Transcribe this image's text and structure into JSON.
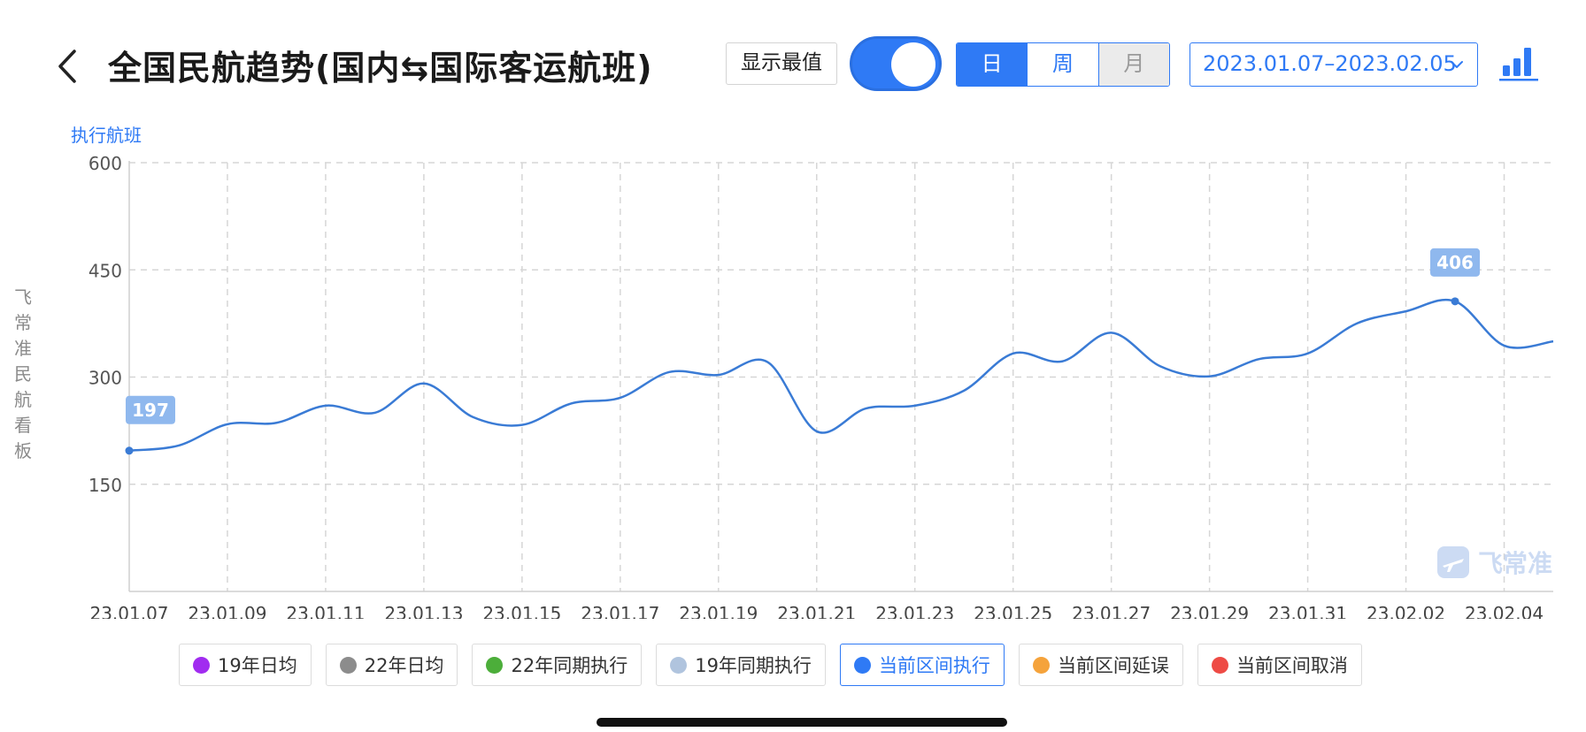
{
  "header": {
    "title": "全国民航趋势(国内⇆国际客运航班)",
    "show_max_label": "显示最值",
    "toggle_on": true,
    "periods": [
      "日",
      "周",
      "月"
    ],
    "selected_period": "日",
    "date_range": "2023.01.07–2023.02.05"
  },
  "vertical_label": "飞常准民航看板",
  "watermark": "飞常准",
  "colors": {
    "accent": "#2f7af5",
    "line": "#3a7bd5",
    "badge": "#8fb8ee"
  },
  "chart_data": {
    "type": "line",
    "ylabel": "执行航班",
    "ylim": [
      0,
      600
    ],
    "yticks": [
      150,
      300,
      450,
      600
    ],
    "x": [
      "23.01.07",
      "23.01.08",
      "23.01.09",
      "23.01.10",
      "23.01.11",
      "23.01.12",
      "23.01.13",
      "23.01.14",
      "23.01.15",
      "23.01.16",
      "23.01.17",
      "23.01.18",
      "23.01.19",
      "23.01.20",
      "23.01.21",
      "23.01.22",
      "23.01.23",
      "23.01.24",
      "23.01.25",
      "23.01.26",
      "23.01.27",
      "23.01.28",
      "23.01.29",
      "23.01.30",
      "23.01.31",
      "23.02.01",
      "23.02.02",
      "23.02.03",
      "23.02.04",
      "23.02.05"
    ],
    "xtick_labels": [
      "23.01.07",
      "23.01.09",
      "23.01.11",
      "23.01.13",
      "23.01.15",
      "23.01.17",
      "23.01.19",
      "23.01.21",
      "23.01.23",
      "23.01.25",
      "23.01.27",
      "23.01.29",
      "23.01.31",
      "23.02.02",
      "23.02.04"
    ],
    "series": [
      {
        "values": [
          197,
          204,
          234,
          236,
          260,
          250,
          291,
          244,
          233,
          263,
          271,
          307,
          303,
          321,
          224,
          256,
          260,
          281,
          333,
          322,
          362,
          315,
          301,
          325,
          333,
          375,
          392,
          406,
          344,
          350
        ]
      }
    ],
    "annotations": [
      {
        "label": "197",
        "x": "23.01.07",
        "value": 197
      },
      {
        "label": "406",
        "x": "23.02.03",
        "value": 406
      }
    ],
    "grid": true
  },
  "legend": [
    {
      "label": "19年日均",
      "color": "#a12cf0",
      "active": false
    },
    {
      "label": "22年日均",
      "color": "#8c8c8c",
      "active": false
    },
    {
      "label": "22年同期执行",
      "color": "#4cae3a",
      "active": false
    },
    {
      "label": "19年同期执行",
      "color": "#b0c4de",
      "active": false
    },
    {
      "label": "当前区间执行",
      "color": "#2f7af5",
      "active": true
    },
    {
      "label": "当前区间延误",
      "color": "#f5a33b",
      "active": false
    },
    {
      "label": "当前区间取消",
      "color": "#ee4b45",
      "active": false
    }
  ]
}
